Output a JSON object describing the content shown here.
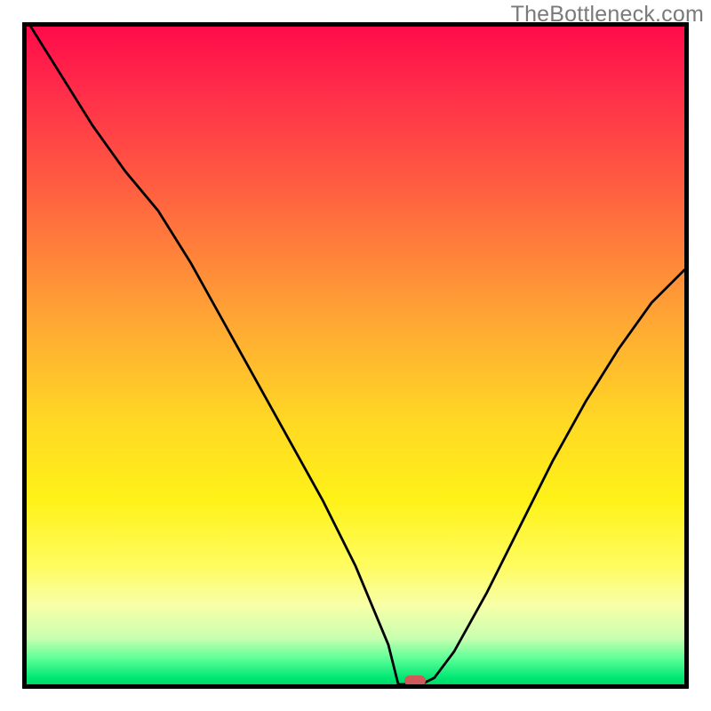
{
  "watermark": "TheBottleneck.com",
  "chart_data": {
    "type": "line",
    "title": "",
    "xlabel": "",
    "ylabel": "",
    "x": [
      0.0,
      0.05,
      0.1,
      0.15,
      0.2,
      0.25,
      0.3,
      0.35,
      0.4,
      0.45,
      0.5,
      0.55,
      0.565,
      0.6,
      0.62,
      0.65,
      0.7,
      0.75,
      0.8,
      0.85,
      0.9,
      0.95,
      1.0
    ],
    "y": [
      1.01,
      0.93,
      0.85,
      0.78,
      0.72,
      0.64,
      0.55,
      0.46,
      0.37,
      0.28,
      0.18,
      0.06,
      0.0,
      0.0,
      0.01,
      0.05,
      0.14,
      0.24,
      0.34,
      0.43,
      0.51,
      0.58,
      0.63
    ],
    "xlim": [
      0,
      1
    ],
    "ylim": [
      0,
      1
    ],
    "marker": {
      "x": 0.59,
      "y": 0.0
    },
    "gradient_stops": [
      {
        "pos": 0.0,
        "color": "#ff0b4a"
      },
      {
        "pos": 0.25,
        "color": "#ff6040"
      },
      {
        "pos": 0.6,
        "color": "#ffd824"
      },
      {
        "pos": 0.82,
        "color": "#fffc60"
      },
      {
        "pos": 0.93,
        "color": "#c8ffb0"
      },
      {
        "pos": 1.0,
        "color": "#00d868"
      }
    ]
  }
}
